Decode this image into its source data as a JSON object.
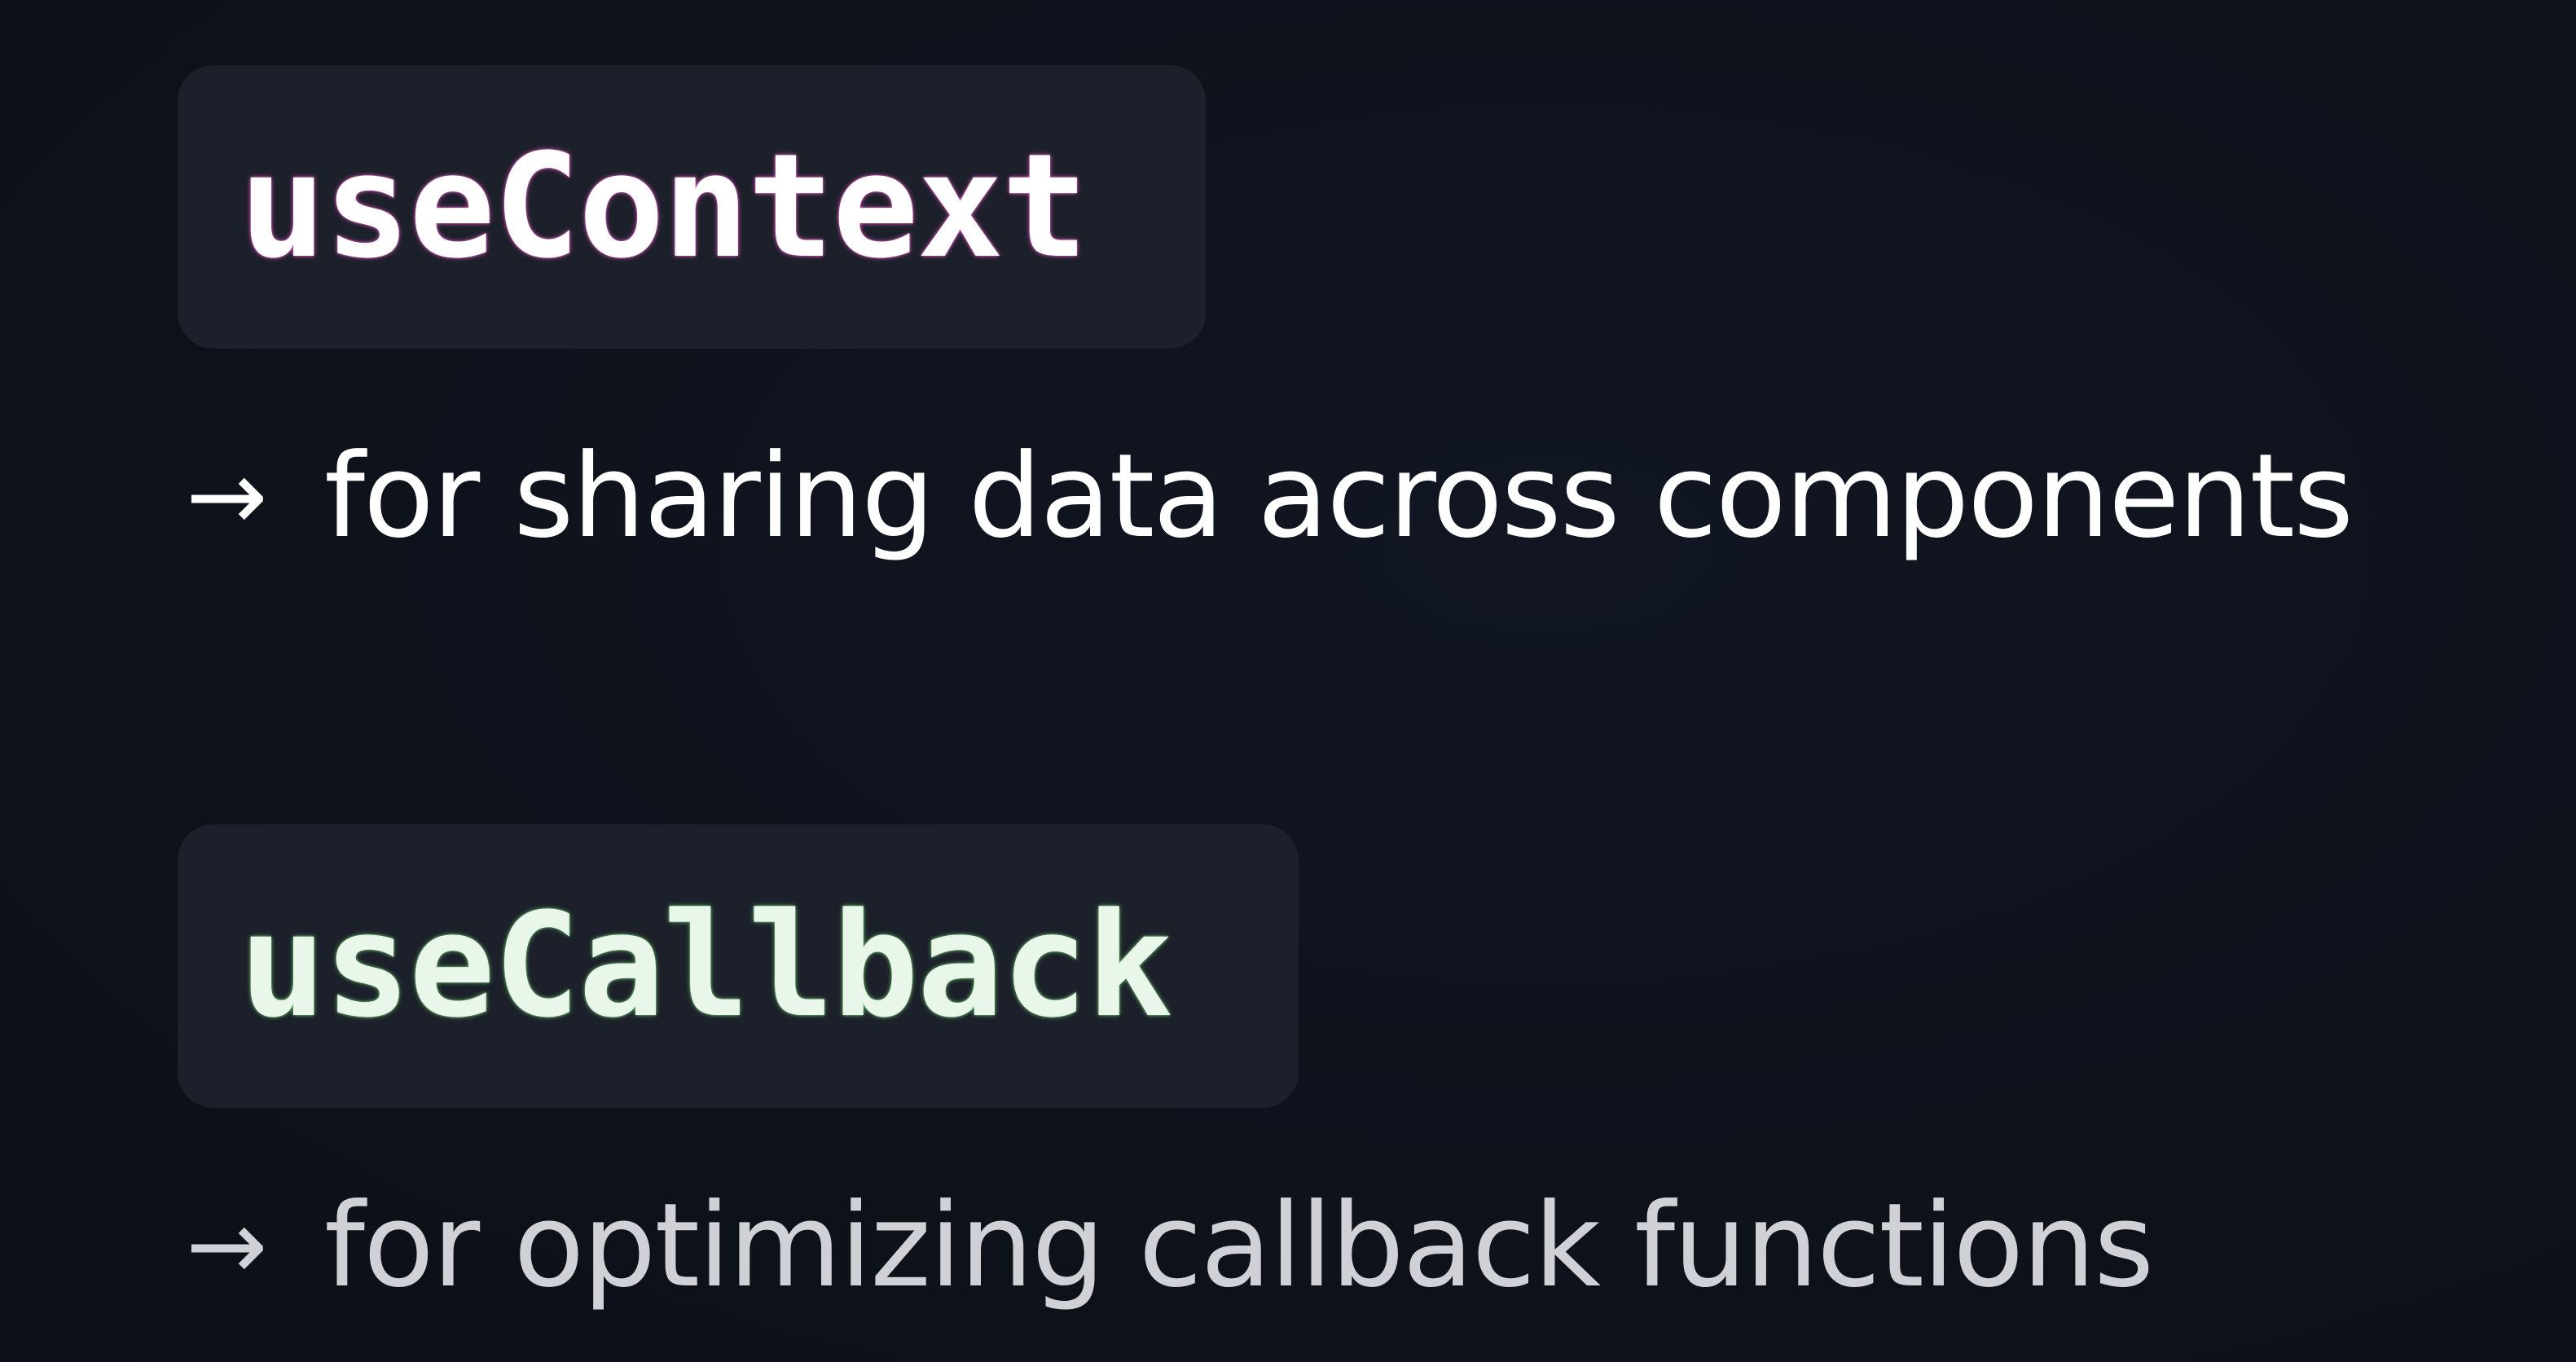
{
  "hooks": [
    {
      "name": "useContext",
      "arrow": "→",
      "description": "for sharing data across components",
      "glow_color": "#e75cc8"
    },
    {
      "name": "useCallback",
      "arrow": "→",
      "description": "for optimizing callback functions",
      "glow_color": "#78d278"
    }
  ],
  "colors": {
    "background": "#0e121b",
    "chip_background": "#1c202a",
    "primary_text": "#ffffff",
    "secondary_text": "#d0d1d6"
  }
}
